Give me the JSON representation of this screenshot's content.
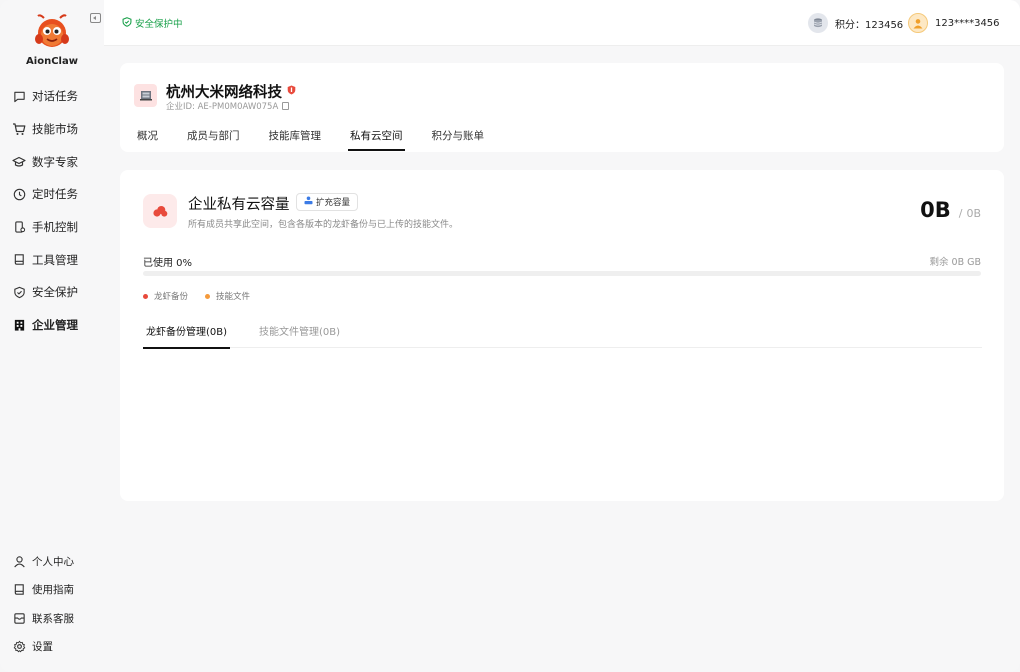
{
  "app": {
    "name": "AionClaw"
  },
  "sidebar": {
    "items": [
      {
        "label": "对话任务",
        "icon": "chat-icon"
      },
      {
        "label": "技能市场",
        "icon": "cart-icon"
      },
      {
        "label": "数字专家",
        "icon": "graduation-cap-icon"
      },
      {
        "label": "定时任务",
        "icon": "clock-icon"
      },
      {
        "label": "手机控制",
        "icon": "phone-icon"
      },
      {
        "label": "工具管理",
        "icon": "book-icon"
      },
      {
        "label": "安全保护",
        "icon": "shield-icon"
      },
      {
        "label": "企业管理",
        "icon": "building-icon",
        "active": true
      }
    ],
    "bottom": [
      {
        "label": "个人中心",
        "icon": "user-icon"
      },
      {
        "label": "使用指南",
        "icon": "guide-icon"
      },
      {
        "label": "联系客服",
        "icon": "mail-icon"
      },
      {
        "label": "设置",
        "icon": "gear-icon"
      }
    ]
  },
  "topbar": {
    "safe_text": "安全保护中",
    "points_label": "积分：123456",
    "user_name": "123****3456"
  },
  "company": {
    "name": "杭州大米网络科技",
    "id_text": "企业ID: AE-PM0M0AW075A",
    "tabs": [
      "概况",
      "成员与部门",
      "技能库管理",
      "私有云空间",
      "积分与账单"
    ],
    "active_tab": 3
  },
  "storage": {
    "title": "企业私有云容量",
    "expand_label": "扩充容量",
    "description": "所有成员共享此空间，包含各版本的龙虾备份与已上传的技能文件。",
    "used_value": "0B",
    "separator": "/",
    "total_value": "0B",
    "used_label": "已使用 0%",
    "remain_label": "剩余 0B GB",
    "used_percent": 0,
    "legend": [
      {
        "label": "龙虾备份",
        "color": "#e84a3c"
      },
      {
        "label": "技能文件",
        "color": "#f59a3c"
      }
    ],
    "subtabs": [
      "龙虾备份管理(0B)",
      "技能文件管理(0B)"
    ],
    "active_subtab": 0
  },
  "colors": {
    "accent": "#e84a3c",
    "safe": "#19a04a"
  }
}
